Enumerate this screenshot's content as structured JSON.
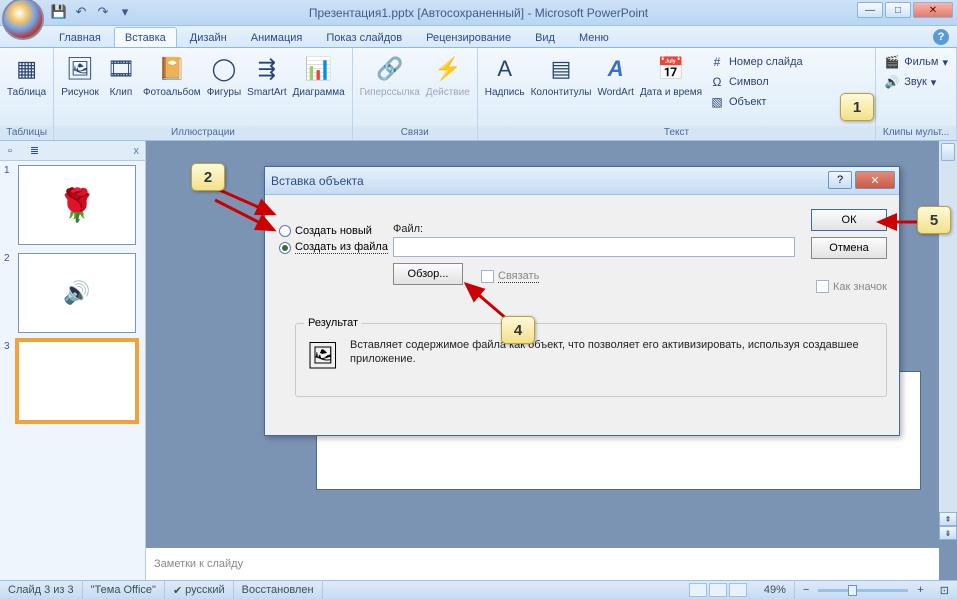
{
  "titlebar": {
    "title": "Презентация1.pptx [Автосохраненный] - Microsoft PowerPoint"
  },
  "tabs": {
    "items": [
      "Главная",
      "Вставка",
      "Дизайн",
      "Анимация",
      "Показ слайдов",
      "Рецензирование",
      "Вид",
      "Меню"
    ],
    "active_index": 1
  },
  "ribbon": {
    "groups": {
      "tables": {
        "label": "Таблицы",
        "table": "Таблица"
      },
      "illustr": {
        "label": "Иллюстрации",
        "picture": "Рисунок",
        "clip": "Клип",
        "album": "Фотоальбом",
        "shapes": "Фигуры",
        "smartart": "SmartArt",
        "chart": "Диаграмма"
      },
      "links": {
        "label": "Связи",
        "hyperlink": "Гиперссылка",
        "action": "Действие"
      },
      "text": {
        "label": "Текст",
        "textbox": "Надпись",
        "headerfooter": "Колонтитулы",
        "wordart": "WordArt",
        "datetime": "Дата и время",
        "slidenum": "Номер слайда",
        "symbol": "Символ",
        "object": "Объект"
      },
      "media": {
        "label": "Клипы мульт...",
        "movie": "Фильм",
        "sound": "Звук"
      }
    }
  },
  "panel": {
    "close": "x"
  },
  "dialog": {
    "title": "Вставка объекта",
    "radio_new": "Создать новый",
    "radio_file": "Создать из файла",
    "file_label": "Файл:",
    "browse": "Обзор...",
    "link": "Связать",
    "as_icon": "Как значок",
    "ok": "ОК",
    "cancel": "Отмена",
    "result_title": "Результат",
    "result_text": "Вставляет содержимое файла как объект, что позволяет его активизировать, используя создавшее приложение."
  },
  "notes": {
    "placeholder": "Заметки к слайду"
  },
  "status": {
    "slide": "Слайд 3 из 3",
    "theme": "\"Тема Office\"",
    "lang": "русский",
    "recovered": "Восстановлен",
    "zoom": "49%"
  },
  "callouts": {
    "c1": "1",
    "c2": "2",
    "c4": "4",
    "c5": "5"
  }
}
